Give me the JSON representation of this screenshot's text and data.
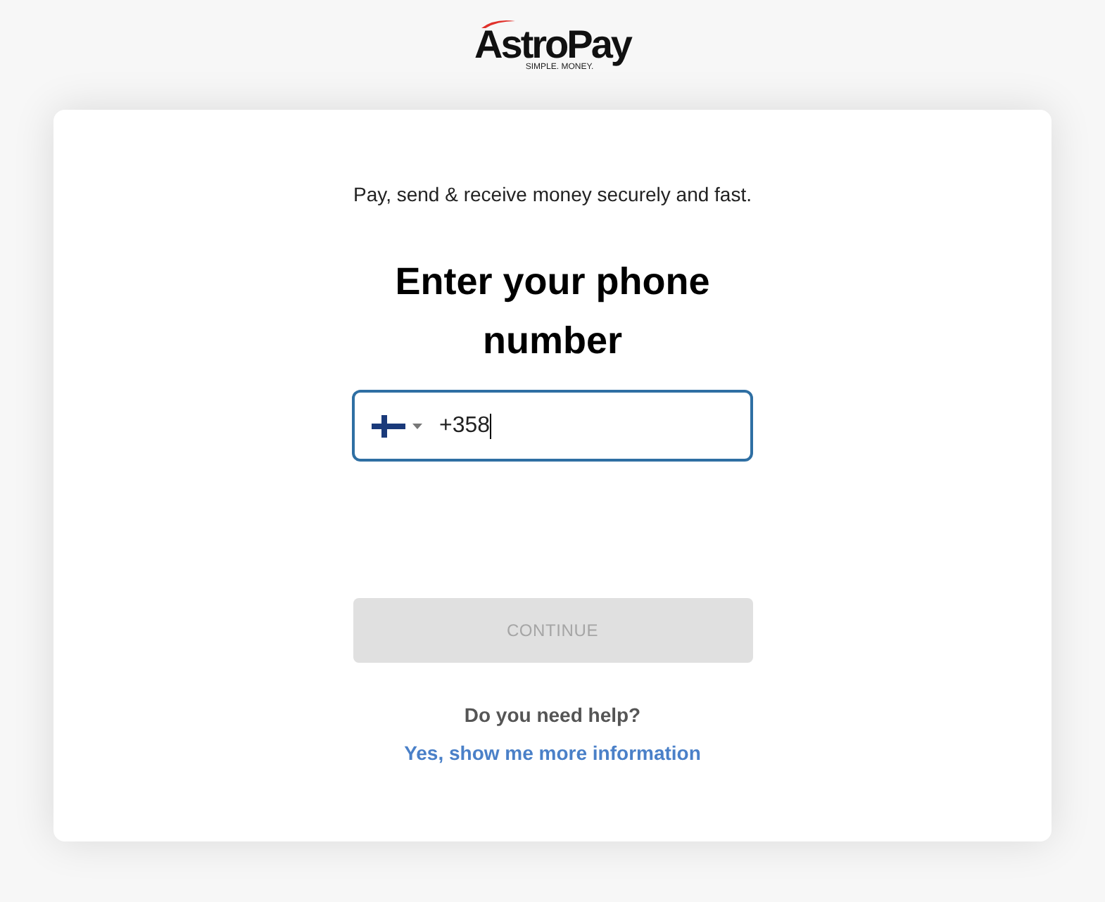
{
  "logo": {
    "name": "AstroPay",
    "tagline": "SIMPLE. MONEY."
  },
  "subtitle": "Pay, send & receive money securely and fast.",
  "heading": "Enter your phone number",
  "phone_field": {
    "value": "+358",
    "focused": true
  },
  "continue_button": {
    "label": "CONTINUE",
    "disabled": true
  },
  "help": {
    "question": "Do you need help?",
    "link": "Yes, show me more information"
  }
}
